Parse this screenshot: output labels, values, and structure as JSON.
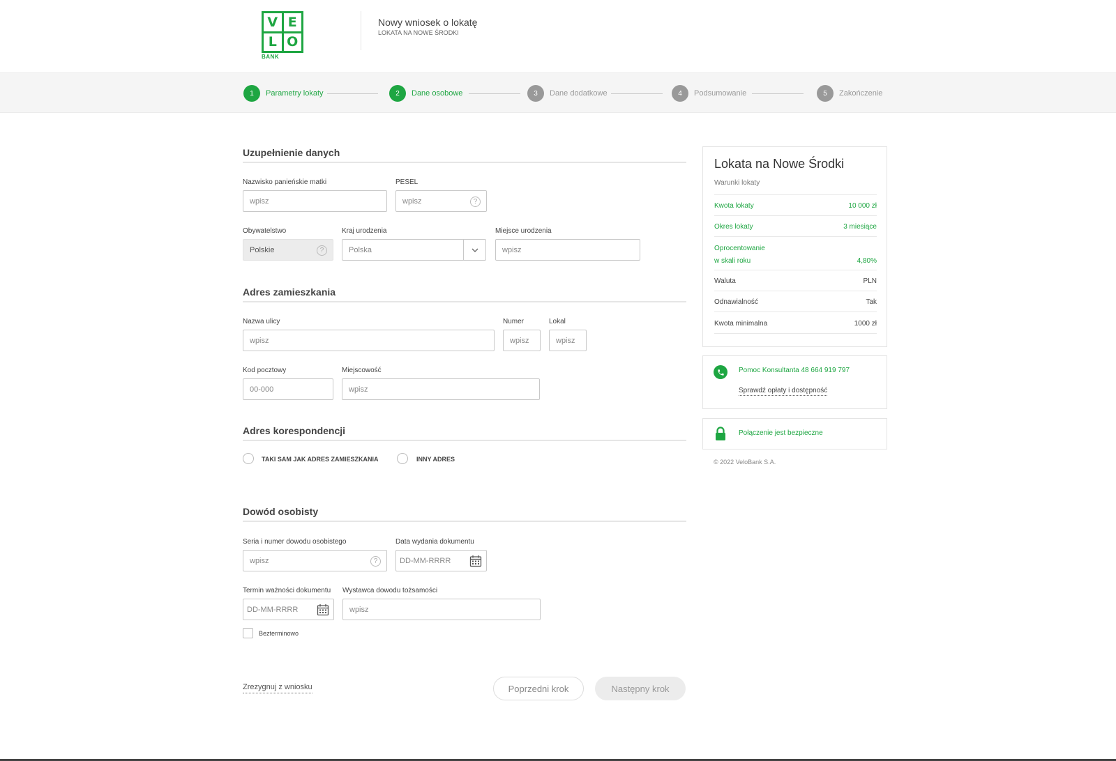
{
  "brand": {
    "logo_letters": [
      "V",
      "E",
      "L",
      "O"
    ],
    "logo_sub": "BANK",
    "color": "#1ea642"
  },
  "header": {
    "title": "Nowy wniosek o lokatę",
    "subtitle": "LOKATA NA NOWE ŚRODKI"
  },
  "stepper": {
    "steps": [
      {
        "num": "1",
        "label": "Parametry lokaty",
        "state": "done"
      },
      {
        "num": "2",
        "label": "Dane osobowe",
        "state": "current"
      },
      {
        "num": "3",
        "label": "Dane dodatkowe",
        "state": "pending"
      },
      {
        "num": "4",
        "label": "Podsumowanie",
        "state": "pending"
      },
      {
        "num": "5",
        "label": "Zakończenie",
        "state": "pending"
      }
    ]
  },
  "sections": {
    "personal": {
      "title": "Uzupełnienie danych",
      "maiden_name": {
        "label": "Nazwisko panieńskie matki",
        "placeholder": "wpisz"
      },
      "pesel": {
        "label": "PESEL",
        "placeholder": "wpisz",
        "icon": "help-icon"
      },
      "citizenship": {
        "label": "Obywatelstwo",
        "value": "Polskie",
        "icon": "help-icon"
      },
      "birth_country": {
        "label": "Kraj urodzenia",
        "value": "Polska",
        "icon": "chevron-down-icon"
      },
      "birth_place": {
        "label": "Miejsce urodzenia",
        "placeholder": "wpisz"
      }
    },
    "address": {
      "title": "Adres zamieszkania",
      "street": {
        "label": "Nazwa ulicy",
        "placeholder": "wpisz"
      },
      "number": {
        "label": "Numer",
        "placeholder": "wpisz"
      },
      "flat": {
        "label": "Lokal",
        "placeholder": "wpisz"
      },
      "postal": {
        "label": "Kod pocztowy",
        "placeholder": "00-000"
      },
      "city": {
        "label": "Miejscowość",
        "placeholder": "wpisz"
      }
    },
    "correspondence": {
      "title": "Adres korespondencji",
      "option_same": "TAKI SAM JAK ADRES ZAMIESZKANIA",
      "option_other": "INNY ADRES"
    },
    "id_doc": {
      "title": "Dowód osobisty",
      "series": {
        "label": "Seria i numer dowodu osobistego",
        "placeholder": "wpisz",
        "icon": "help-icon"
      },
      "issue_date": {
        "label": "Data wydania dokumentu",
        "placeholder": "DD-MM-RRRR",
        "icon": "calendar-icon"
      },
      "expiry_date": {
        "label": "Termin ważności dokumentu",
        "placeholder": "DD-MM-RRRR",
        "icon": "calendar-icon"
      },
      "issuer": {
        "label": "Wystawca dowodu tożsamości",
        "placeholder": "wpisz"
      },
      "indefinite": "Bezterminowo"
    }
  },
  "actions": {
    "resign": "Zrezygnuj z wniosku",
    "prev": "Poprzedni krok",
    "next": "Następny krok"
  },
  "sidebar": {
    "title": "Lokata na Nowe Środki",
    "subtitle": "Warunki lokaty",
    "rows": [
      {
        "k": "Kwota lokaty",
        "v": "10 000 zł",
        "green": true
      },
      {
        "k": "Okres lokaty",
        "v": "3 miesiące",
        "green": true
      },
      {
        "k": "Oprocentowanie",
        "k2": "w skali roku",
        "v": "4,80%",
        "green": true
      },
      {
        "k": "Waluta",
        "v": "PLN",
        "green": false
      },
      {
        "k": "Odnawialność",
        "v": "Tak",
        "green": false
      },
      {
        "k": "Kwota minimalna",
        "v": "1000 zł",
        "green": false
      }
    ],
    "help_text": "Pomoc Konsultanta 48 664 919 797",
    "help_link": "Sprawdź opłaty i dostępność",
    "secure_text": "Połączenie jest bezpieczne",
    "copyright": "© 2022 VeloBank S.A."
  }
}
